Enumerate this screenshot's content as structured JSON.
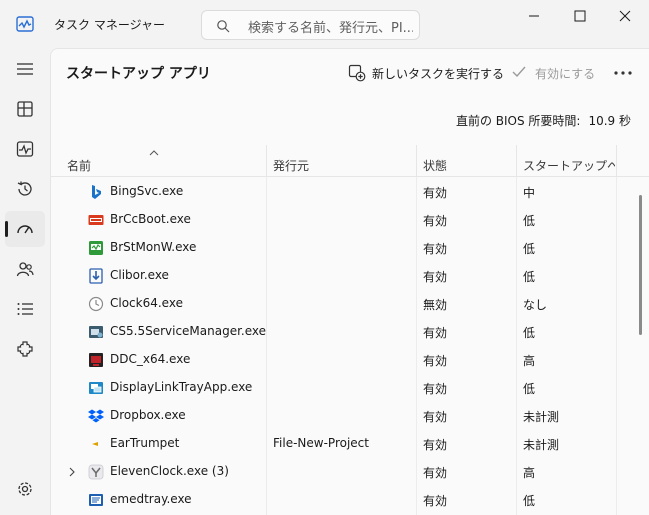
{
  "window": {
    "title": "タスク マネージャー",
    "search_placeholder": "検索する名前、発行元、PI..."
  },
  "sidebar": {
    "items": [
      {
        "id": "menu",
        "icon": "hamburger-icon"
      },
      {
        "id": "processes",
        "icon": "processes-icon"
      },
      {
        "id": "performance",
        "icon": "performance-icon"
      },
      {
        "id": "app-history",
        "icon": "history-icon"
      },
      {
        "id": "startup",
        "icon": "startup-gauge-icon",
        "active": true
      },
      {
        "id": "users",
        "icon": "users-icon"
      },
      {
        "id": "details",
        "icon": "details-list-icon"
      },
      {
        "id": "services",
        "icon": "services-icon"
      },
      {
        "id": "settings",
        "icon": "settings-gear-icon"
      }
    ]
  },
  "page": {
    "title": "スタートアップ アプリ",
    "run_new_task": "新しいタスクを実行する",
    "enable": "有効にする",
    "bios_label": "直前の BIOS 所要時間:",
    "bios_value": "10.9 秒"
  },
  "columns": {
    "name": "名前",
    "publisher": "発行元",
    "status": "状態",
    "impact": "スタートアップへ..."
  },
  "rows": [
    {
      "name": "BingSvc.exe",
      "publisher": "",
      "status": "有効",
      "impact": "中",
      "icon": "bing-icon",
      "color": "#1a73c8"
    },
    {
      "name": "BrCcBoot.exe",
      "publisher": "",
      "status": "有効",
      "impact": "低",
      "icon": "brother-ccboot-icon",
      "color": "#d93a1e"
    },
    {
      "name": "BrStMonW.exe",
      "publisher": "",
      "status": "有効",
      "impact": "低",
      "icon": "brother-status-monitor-icon",
      "color": "#2e9a3a"
    },
    {
      "name": "Clibor.exe",
      "publisher": "",
      "status": "有効",
      "impact": "低",
      "icon": "clibor-icon",
      "color": "#2c5fb0"
    },
    {
      "name": "Clock64.exe",
      "publisher": "",
      "status": "無効",
      "impact": "なし",
      "icon": "clock-icon",
      "color": "#8a8a8a"
    },
    {
      "name": "CS5.5ServiceManager.exe",
      "publisher": "",
      "status": "有効",
      "impact": "低",
      "icon": "cs-service-manager-icon",
      "color": "#3b5b6e"
    },
    {
      "name": "DDC_x64.exe",
      "publisher": "",
      "status": "有効",
      "impact": "高",
      "icon": "ddc-icon",
      "color": "#c0242a"
    },
    {
      "name": "DisplayLinkTrayApp.exe",
      "publisher": "",
      "status": "有効",
      "impact": "低",
      "icon": "displaylink-icon",
      "color": "#1e88c8"
    },
    {
      "name": "Dropbox.exe",
      "publisher": "",
      "status": "有効",
      "impact": "未計測",
      "icon": "dropbox-icon",
      "color": "#0061fe"
    },
    {
      "name": "EarTrumpet",
      "publisher": "File-New-Project",
      "status": "有効",
      "impact": "未計測",
      "icon": "eartrumpet-icon",
      "color": "#e0a000"
    },
    {
      "name": "ElevenClock.exe (3)",
      "publisher": "",
      "status": "有効",
      "impact": "高",
      "icon": "elevenclock-icon",
      "color": "#6a6a6a",
      "expandable": true
    },
    {
      "name": "emedtray.exe",
      "publisher": "",
      "status": "有効",
      "impact": "低",
      "icon": "emeditor-tray-icon",
      "color": "#1d5fb0"
    }
  ]
}
